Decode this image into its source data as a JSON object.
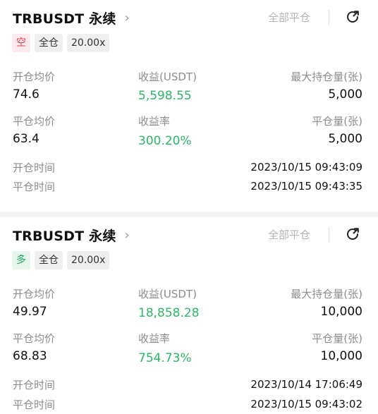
{
  "positions": [
    {
      "symbol": "TRBUSDT 永续",
      "close_all": "全部平仓",
      "tags": {
        "side": "空",
        "margin": "全仓",
        "leverage": "20.00x"
      },
      "open_avg_label": "开仓均价",
      "open_avg": "74.6",
      "pnl_label": "收益(USDT)",
      "pnl": "5,598.55",
      "max_hold_label": "最大持仓量(张)",
      "max_hold": "5,000",
      "close_avg_label": "平仓均价",
      "close_avg": "63.4",
      "roe_label": "收益率",
      "roe": "300.20%",
      "close_qty_label": "平仓量(张)",
      "close_qty": "5,000",
      "open_time_label": "开仓时间",
      "open_time": "2023/10/15 09:43:09",
      "close_time_label": "平仓时间",
      "close_time": "2023/10/15 09:43:35"
    },
    {
      "symbol": "TRBUSDT 永续",
      "close_all": "全部平仓",
      "tags": {
        "side": "多",
        "margin": "全仓",
        "leverage": "20.00x"
      },
      "open_avg_label": "开仓均价",
      "open_avg": "49.97",
      "pnl_label": "收益(USDT)",
      "pnl": "18,858.28",
      "max_hold_label": "最大持仓量(张)",
      "max_hold": "10,000",
      "close_avg_label": "平仓均价",
      "close_avg": "68.83",
      "roe_label": "收益率",
      "roe": "754.73%",
      "close_qty_label": "平仓量(张)",
      "close_qty": "10,000",
      "open_time_label": "开仓时间",
      "open_time": "2023/10/14 17:06:49",
      "close_time_label": "平仓时间",
      "close_time": "2023/10/15 09:43:02"
    }
  ],
  "colors": {
    "profit": "#2fb56a",
    "short": "#e0454f",
    "long": "#25a75b"
  },
  "icons": {
    "chevron": "chevron-right-icon",
    "share": "share-icon"
  }
}
